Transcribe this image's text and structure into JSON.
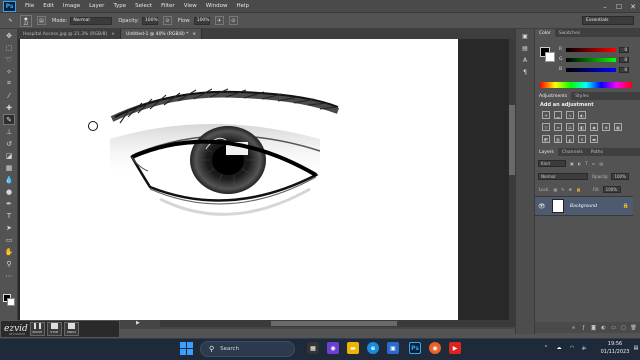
{
  "menubar": {
    "logo": "Ps",
    "items": [
      "File",
      "Edit",
      "Image",
      "Layer",
      "Type",
      "Select",
      "Filter",
      "View",
      "Window",
      "Help"
    ]
  },
  "options": {
    "brush_size": "22",
    "mode_label": "Mode:",
    "mode_value": "Normal",
    "opacity_label": "Opacity:",
    "opacity_value": "100%",
    "flow_label": "Flow:",
    "flow_value": "100%",
    "workspace": "Essentials"
  },
  "doc_tabs": [
    {
      "label": "Hospital Access.jpg @ 21.3% (RGB/8)",
      "close": "×"
    },
    {
      "label": "Untitled-1 @ 40% (RGB/8) *",
      "close": "×"
    }
  ],
  "color_panel": {
    "tabs": [
      "Color",
      "Swatches"
    ],
    "sliders": [
      {
        "label": "R",
        "value": "0",
        "color": "#e03030"
      },
      {
        "label": "G",
        "value": "0",
        "color": "#30c030"
      },
      {
        "label": "B",
        "value": "0",
        "color": "#3050e0"
      }
    ]
  },
  "adjustments": {
    "tabs": [
      "Adjustments",
      "Styles"
    ],
    "heading": "Add an adjustment"
  },
  "layers": {
    "tabs": [
      "Layers",
      "Channels",
      "Paths"
    ],
    "kind_label": "Kind",
    "blend_mode": "Normal",
    "opacity_label": "Opacity:",
    "opacity_value": "100%",
    "lock_label": "Lock:",
    "fill_label": "Fill:",
    "fill_value": "100%",
    "layer_name": "Background"
  },
  "status": {
    "arrow": "▶"
  },
  "ezvid": {
    "logo": "ezvid",
    "sub": "RECORDER",
    "buttons": [
      "PAUSE",
      "STOP",
      "UNDO"
    ]
  },
  "taskbar": {
    "search_placeholder": "Search",
    "time": "19:56",
    "date": "01/11/2023"
  },
  "colors": {
    "accent": "#31a8ff",
    "selected_layer": "#4d5a70",
    "taskbar": "#1e2a3a"
  }
}
